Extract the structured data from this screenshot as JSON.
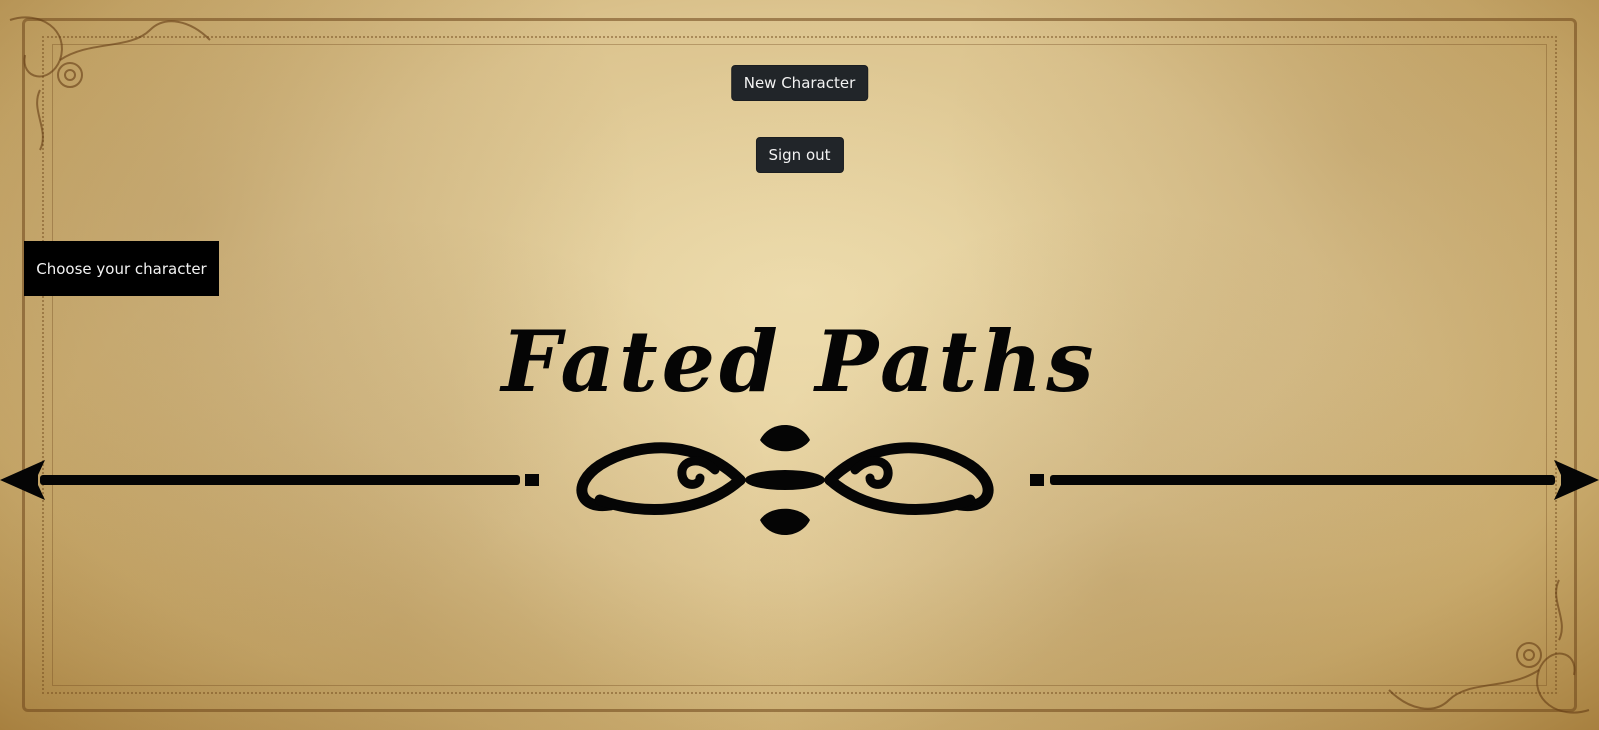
{
  "header": {
    "new_character_label": "New Character",
    "sign_out_label": "Sign out"
  },
  "sidebar": {
    "choose_character_label": "Choose your character"
  },
  "main": {
    "title": "Fated Paths"
  },
  "colors": {
    "parchment": "#dcc48f",
    "button_dark": "#212529",
    "button_black": "#000000",
    "ink": "#050505"
  }
}
